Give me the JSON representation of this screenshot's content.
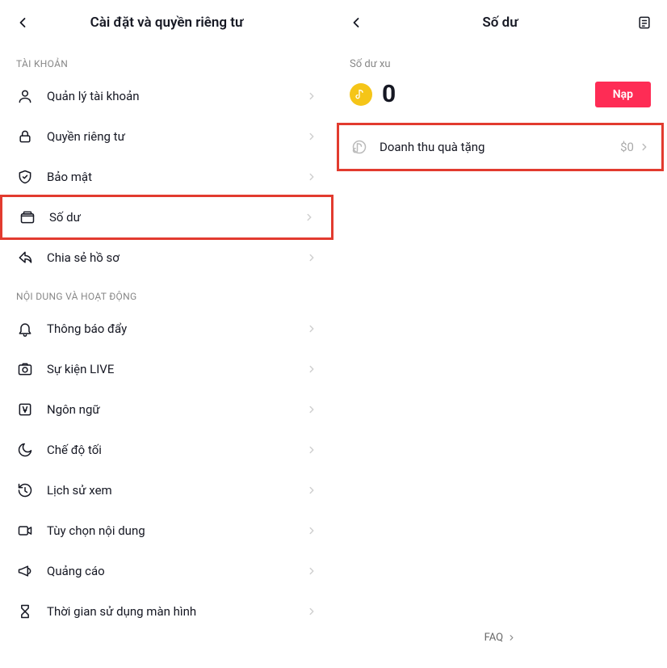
{
  "left": {
    "title": "Cài đặt và quyền riêng tư",
    "sections": {
      "account": {
        "label": "TÀI KHOẢN",
        "items": {
          "manage": "Quản lý tài khoản",
          "privacy": "Quyền riêng tư",
          "security": "Bảo mật",
          "balance": "Số dư",
          "share": "Chia sẻ hồ sơ"
        }
      },
      "content": {
        "label": "NỘI DUNG VÀ HOẠT ĐỘNG",
        "items": {
          "push": "Thông báo đẩy",
          "live": "Sự kiện LIVE",
          "lang": "Ngôn ngữ",
          "dark": "Chế độ tối",
          "watch": "Lịch sử xem",
          "contentpref": "Tùy chọn nội dung",
          "ads": "Quảng cáo",
          "screentime": "Thời gian sử dụng màn hình"
        }
      }
    }
  },
  "right": {
    "title": "Số dư",
    "coin_label": "Số dư xu",
    "coin_balance": "0",
    "recharge": "Nạp",
    "gift_revenue_label": "Doanh thu quà tặng",
    "gift_revenue_amount": "$0",
    "faq": "FAQ"
  }
}
